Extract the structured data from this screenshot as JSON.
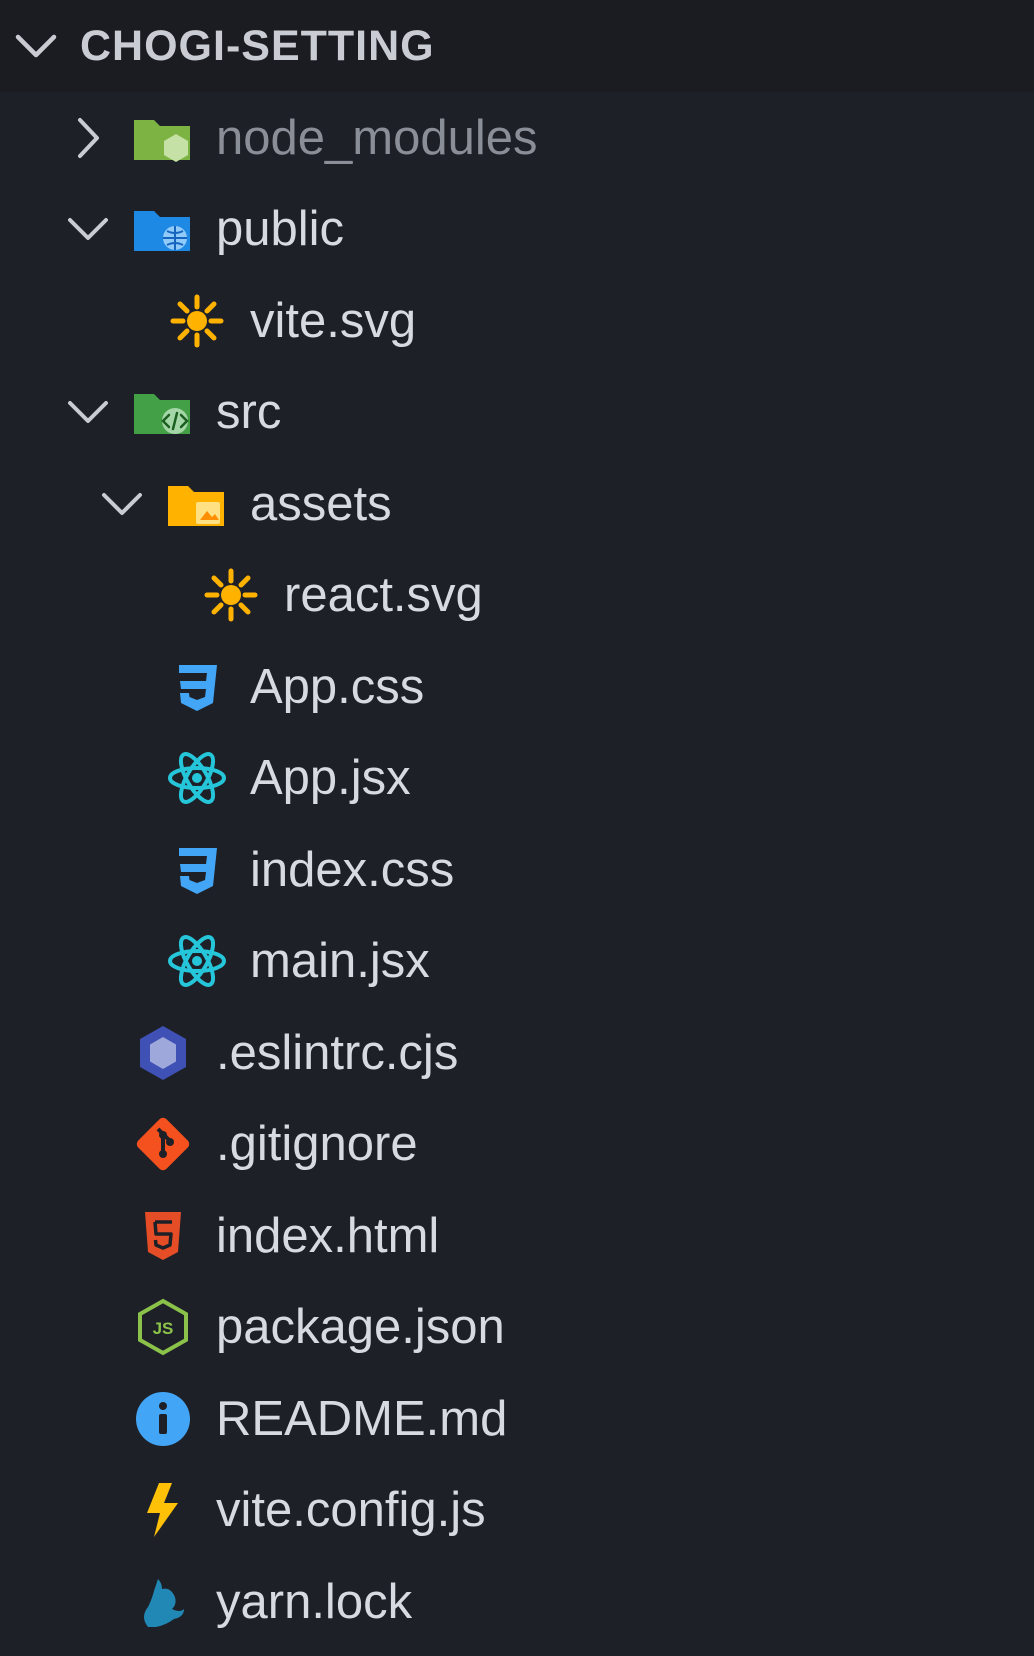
{
  "explorer": {
    "title": "CHOGI-SETTING",
    "items": [
      {
        "label": "node_modules",
        "icon": "node-modules-folder-icon",
        "twisty": "chevron-right-icon",
        "depth": 0
      },
      {
        "label": "public",
        "icon": "public-folder-icon",
        "twisty": "chevron-down-icon",
        "depth": 0
      },
      {
        "label": "vite.svg",
        "icon": "svg-file-icon",
        "depth": 1
      },
      {
        "label": "src",
        "icon": "src-folder-icon",
        "twisty": "chevron-down-icon",
        "depth": 0
      },
      {
        "label": "assets",
        "icon": "assets-folder-icon",
        "twisty": "chevron-down-icon",
        "depth": 1
      },
      {
        "label": "react.svg",
        "icon": "svg-file-icon",
        "depth": 2
      },
      {
        "label": "App.css",
        "icon": "css-file-icon",
        "depth": 1
      },
      {
        "label": "App.jsx",
        "icon": "react-file-icon",
        "depth": 1
      },
      {
        "label": "index.css",
        "icon": "css-file-icon",
        "depth": 1
      },
      {
        "label": "main.jsx",
        "icon": "react-file-icon",
        "depth": 1
      },
      {
        "label": ".eslintrc.cjs",
        "icon": "eslint-file-icon",
        "depth": 0
      },
      {
        "label": ".gitignore",
        "icon": "git-file-icon",
        "depth": 0
      },
      {
        "label": "index.html",
        "icon": "html-file-icon",
        "depth": 0
      },
      {
        "label": "package.json",
        "icon": "nodejs-file-icon",
        "depth": 0
      },
      {
        "label": "README.md",
        "icon": "info-file-icon",
        "depth": 0
      },
      {
        "label": "vite.config.js",
        "icon": "vite-file-icon",
        "depth": 0
      },
      {
        "label": "yarn.lock",
        "icon": "yarn-file-icon",
        "depth": 0
      }
    ]
  },
  "colors": {
    "background": "#1e2028",
    "header_background": "#1a1c22",
    "text": "#d7dae0",
    "dim_text": "#8a8e97"
  }
}
